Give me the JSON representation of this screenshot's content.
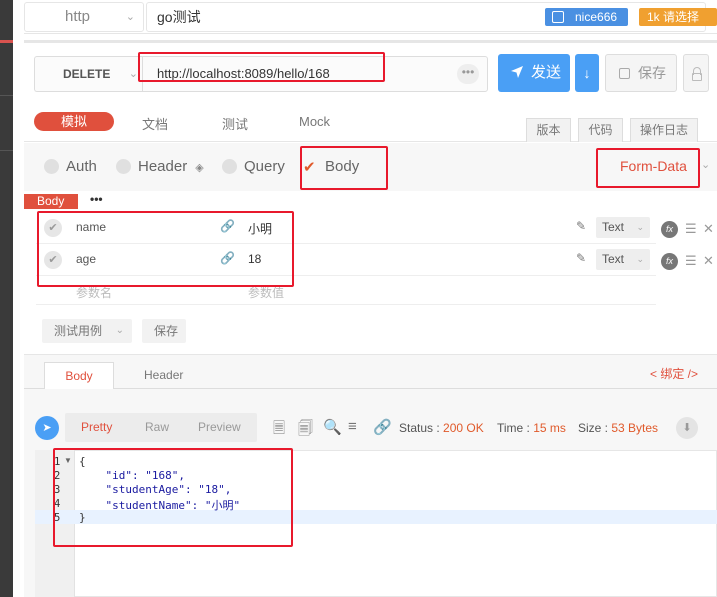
{
  "top": {
    "protocol": "http",
    "api_name": "go测试",
    "user": "nice666",
    "select_btn": "请选择",
    "select_prefix": "1k"
  },
  "request": {
    "method": "DELETE",
    "url": "http://localhost:8089/hello/168",
    "more": "•••",
    "send_label": "发送",
    "save_label": "保存"
  },
  "tabs": {
    "items": [
      "模拟",
      "文档",
      "测试",
      "Mock"
    ],
    "right": [
      "版本",
      "代码",
      "操作日志"
    ]
  },
  "params": {
    "tabs": [
      "Auth",
      "Header",
      "Query",
      "Body"
    ],
    "mode": "Form-Data",
    "body_label": "Body",
    "dots": "•••",
    "rows": [
      {
        "key": "name",
        "value": "小明",
        "type": "Text"
      },
      {
        "key": "age",
        "value": "18",
        "type": "Text"
      }
    ],
    "key_placeholder": "参数名",
    "value_placeholder": "参数值",
    "test_case_btn": "测试用例",
    "save_btn": "保存"
  },
  "response": {
    "tabs": [
      "Body",
      "Header"
    ],
    "bind": "< 绑定 />",
    "view_tabs": [
      "Pretty",
      "Raw",
      "Preview"
    ],
    "status_label": "Status :",
    "status_value": "200 OK",
    "time_label": "Time :",
    "time_value": "15 ms",
    "size_label": "Size :",
    "size_value": "53 Bytes",
    "line_numbers": [
      "1",
      "2",
      "3",
      "4",
      "5"
    ],
    "code_lines": [
      "{",
      "    \"id\": \"168\",",
      "    \"studentAge\": \"18\",",
      "    \"studentName\": \"小明\"",
      "}"
    ]
  },
  "colors": {
    "accent": "#e0503d",
    "primary": "#4a9ff5",
    "highlight": "#e8192c"
  }
}
